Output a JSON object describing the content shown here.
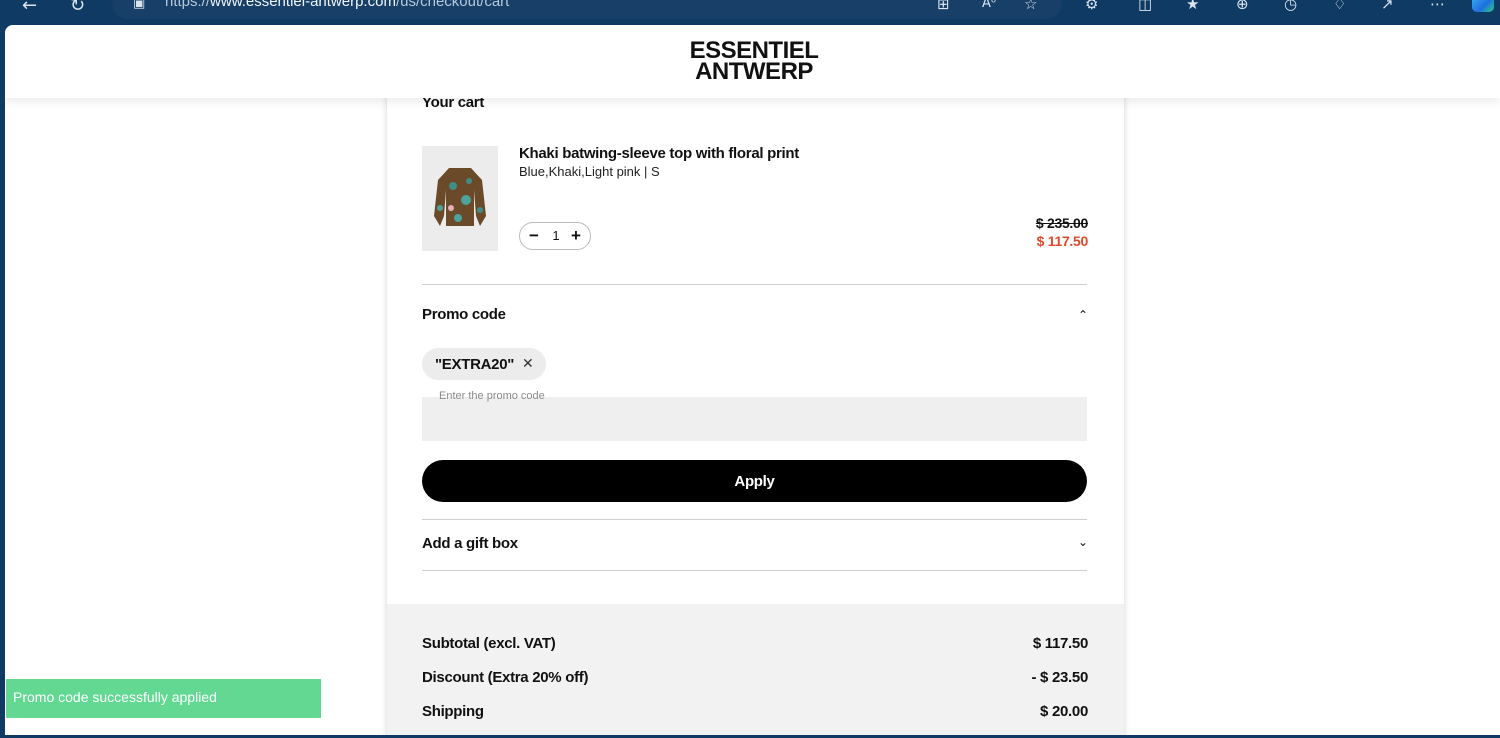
{
  "browser": {
    "url_prefix": "https://",
    "url_domain": "www.essentiel-antwerp.com",
    "url_path": "/us/checkout/cart",
    "icons": [
      "back-icon",
      "refresh-icon",
      "site-info-icon",
      "app-grid-icon",
      "read-aloud-icon",
      "favorite-star-icon",
      "extensions-icon",
      "split-screen-icon",
      "favorites-icon",
      "collections-icon",
      "history-icon",
      "performance-icon",
      "share-icon",
      "more-icon",
      "copilot-icon"
    ]
  },
  "header": {
    "logo_line1": "ESSENTIEL",
    "logo_line2": "ANTWERP"
  },
  "cart": {
    "title": "Your cart",
    "item": {
      "name": "Khaki batwing-sleeve top with floral print",
      "variant": "Blue,Khaki,Light pink | S",
      "quantity": "1",
      "minus": "−",
      "plus": "+",
      "price_original": "$ 235.00",
      "price_sale": "$ 117.50"
    }
  },
  "promo": {
    "title": "Promo code",
    "applied_code": "\"EXTRA20\"",
    "input_label": "Enter the promo code",
    "input_value": "",
    "apply_label": "Apply"
  },
  "gift": {
    "title": "Add a gift box"
  },
  "summary": {
    "subtotal_label": "Subtotal (excl. VAT)",
    "subtotal_value": "$ 117.50",
    "discount_label": "Discount (Extra 20% off)",
    "discount_value": "- $ 23.50",
    "shipping_label": "Shipping",
    "shipping_value": "$ 20.00"
  },
  "toast": {
    "message": "Promo code successfully applied"
  },
  "colors": {
    "sale_price": "#e04a2b",
    "toast_bg": "#62d893",
    "apply_bg": "#000000",
    "browser_frame": "#0f3a63"
  }
}
